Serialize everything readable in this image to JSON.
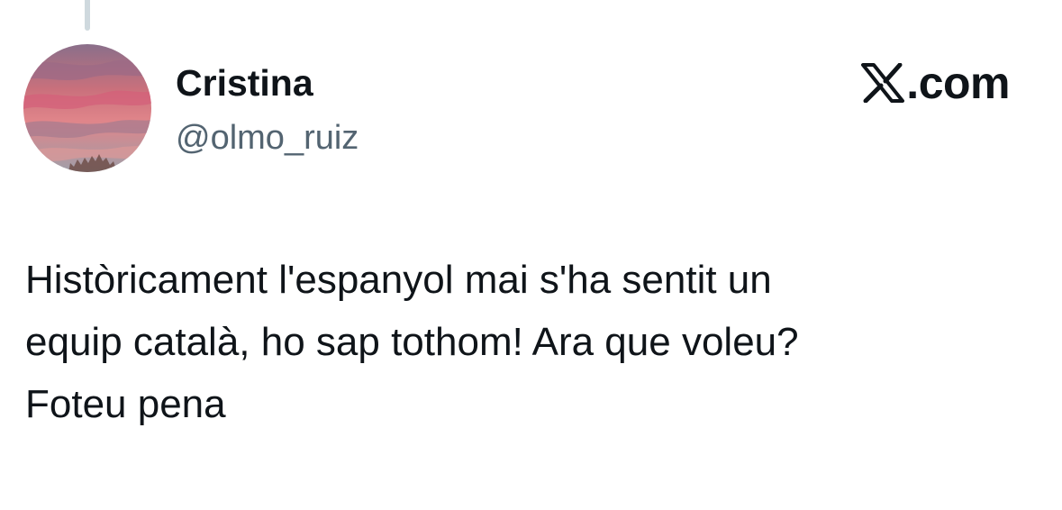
{
  "author": {
    "display_name": "Cristina",
    "handle": "@olmo_ruiz",
    "avatar_icon": "sunset-sky-avatar"
  },
  "brand": {
    "icon": "x-logo-icon",
    "domain": ".com"
  },
  "tweet": {
    "lines": [
      "Històricament l'espanyol mai s'ha sentit un",
      "equip català, ho sap tothom! Ara que voleu?",
      "Foteu pena"
    ]
  },
  "colors": {
    "text_primary": "#0f1419",
    "text_secondary": "#536471",
    "thread_line": "#cfd9de"
  }
}
